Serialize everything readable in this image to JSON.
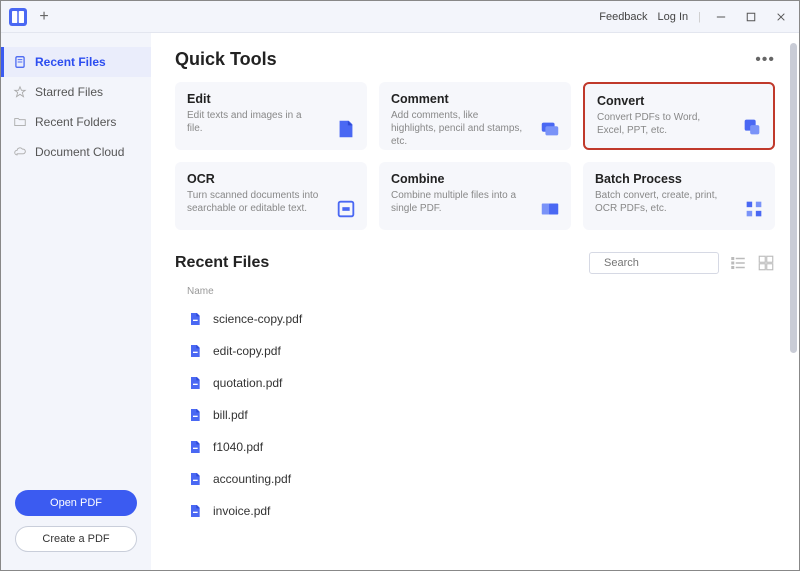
{
  "titlebar": {
    "feedback": "Feedback",
    "login": "Log In"
  },
  "sidebar": {
    "items": [
      {
        "label": "Recent Files",
        "icon": "recent",
        "active": true
      },
      {
        "label": "Starred Files",
        "icon": "star",
        "active": false
      },
      {
        "label": "Recent Folders",
        "icon": "folder",
        "active": false
      },
      {
        "label": "Document Cloud",
        "icon": "cloud",
        "active": false
      }
    ],
    "open_pdf": "Open PDF",
    "create_pdf": "Create a PDF"
  },
  "quick_tools": {
    "title": "Quick Tools",
    "cards": [
      {
        "name": "Edit",
        "desc": "Edit texts and images in a file.",
        "icon": "edit",
        "highlight": false
      },
      {
        "name": "Comment",
        "desc": "Add comments, like highlights, pencil and stamps, etc.",
        "icon": "comment",
        "highlight": false
      },
      {
        "name": "Convert",
        "desc": "Convert PDFs to Word, Excel, PPT, etc.",
        "icon": "convert",
        "highlight": true
      },
      {
        "name": "OCR",
        "desc": "Turn scanned documents into searchable or editable text.",
        "icon": "ocr",
        "highlight": false
      },
      {
        "name": "Combine",
        "desc": "Combine multiple files into a single PDF.",
        "icon": "combine",
        "highlight": false
      },
      {
        "name": "Batch Process",
        "desc": "Batch convert, create, print, OCR PDFs, etc.",
        "icon": "batch",
        "highlight": false
      }
    ]
  },
  "recent_files": {
    "title": "Recent Files",
    "search_placeholder": "Search",
    "name_header": "Name",
    "files": [
      {
        "name": "science-copy.pdf"
      },
      {
        "name": "edit-copy.pdf"
      },
      {
        "name": "quotation.pdf"
      },
      {
        "name": "bill.pdf"
      },
      {
        "name": "f1040.pdf"
      },
      {
        "name": "accounting.pdf"
      },
      {
        "name": "invoice.pdf"
      }
    ]
  }
}
